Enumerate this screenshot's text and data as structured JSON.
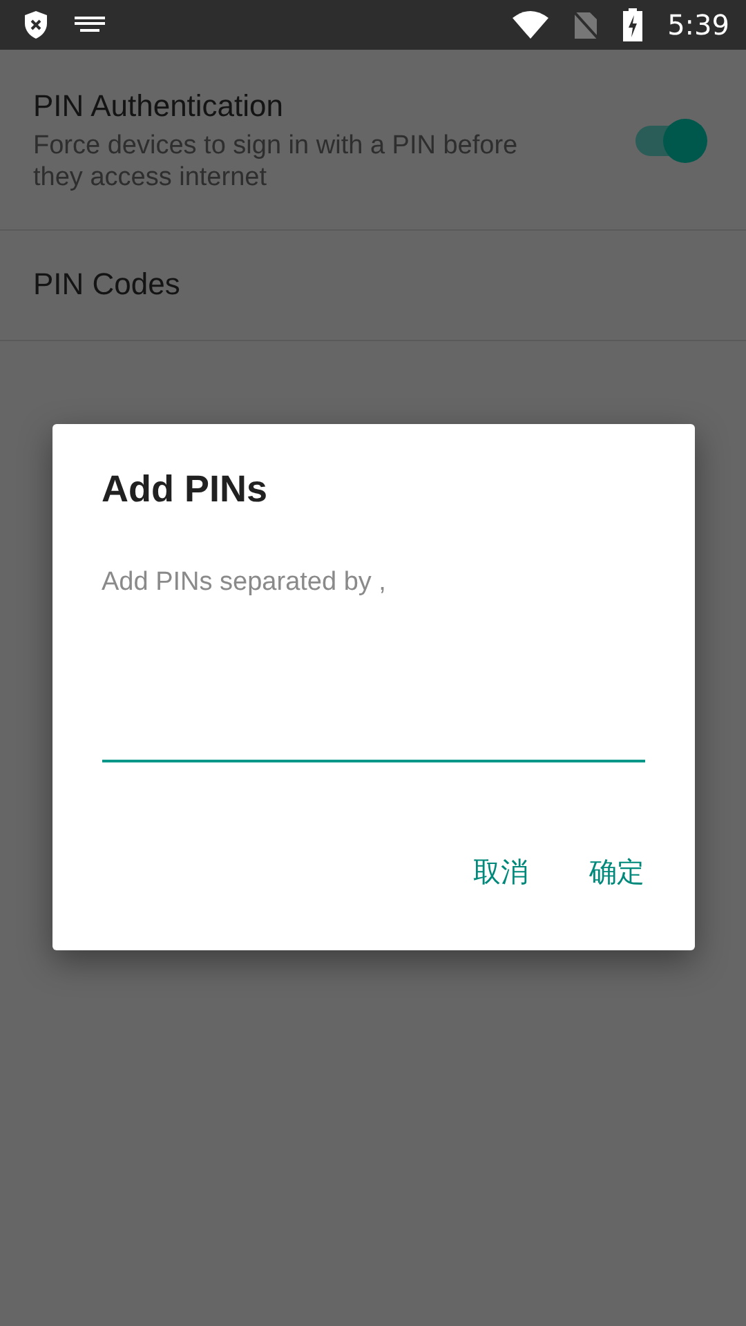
{
  "status_bar": {
    "time": "5:39"
  },
  "settings": [
    {
      "kind": "toggle",
      "title": "PIN Authentication",
      "summary": "Force devices to sign in with a PIN before they access internet",
      "on": true
    },
    {
      "kind": "plain",
      "title": "PIN Codes"
    }
  ],
  "dialog": {
    "title": "Add PINs",
    "field": {
      "placeholder": "Add PINs separated by ,"
    },
    "buttons": [
      "取消",
      "确定"
    ]
  }
}
